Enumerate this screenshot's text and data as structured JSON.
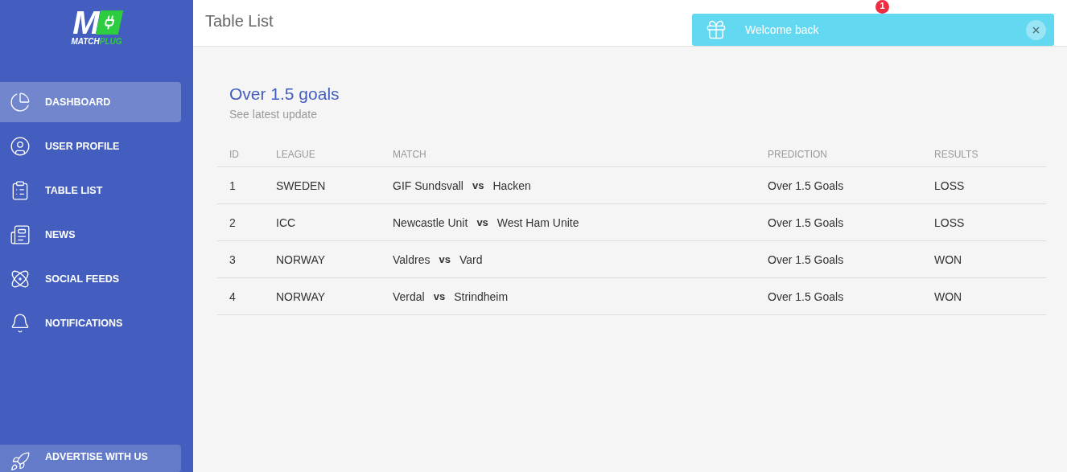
{
  "logo": {
    "letter": "M",
    "word_a": "MATCH",
    "word_b": "PLUG"
  },
  "sidebar": {
    "items": [
      {
        "label": "DASHBOARD",
        "selected": true
      },
      {
        "label": "USER PROFILE",
        "selected": false
      },
      {
        "label": "TABLE LIST",
        "selected": false
      },
      {
        "label": "NEWS",
        "selected": false
      },
      {
        "label": "SOCIAL FEEDS",
        "selected": false
      },
      {
        "label": "NOTIFICATIONS",
        "selected": false
      }
    ],
    "footer_item": {
      "label": "ADVERTISE WITH US"
    }
  },
  "header": {
    "title": "Table List",
    "notification_badge": "1"
  },
  "toast": {
    "message": "Welcome back"
  },
  "card": {
    "title": "Over 1.5 goals",
    "subtitle": "See latest update",
    "columns": [
      "ID",
      "LEAGUE",
      "MATCH",
      "PREDICTION",
      "RESULTS"
    ],
    "rows": [
      {
        "id": "1",
        "league": "SWEDEN",
        "home": "GIF Sundsvall",
        "vs": "vs",
        "away": "Hacken",
        "prediction": "Over 1.5 Goals",
        "result": "LOSS"
      },
      {
        "id": "2",
        "league": "ICC",
        "home": "Newcastle Unit",
        "vs": "vs",
        "away": "West Ham Unite",
        "prediction": "Over 1.5 Goals",
        "result": "LOSS"
      },
      {
        "id": "3",
        "league": "NORWAY",
        "home": "Valdres",
        "vs": "vs",
        "away": "Vard",
        "prediction": "Over 1.5 Goals",
        "result": "WON"
      },
      {
        "id": "4",
        "league": "NORWAY",
        "home": "Verdal",
        "vs": "vs",
        "away": "Strindheim",
        "prediction": "Over 1.5 Goals",
        "result": "WON"
      }
    ]
  }
}
